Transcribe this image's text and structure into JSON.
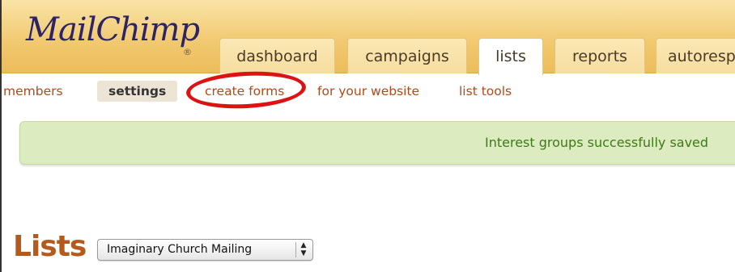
{
  "header": {
    "logo_text": "MailChimp",
    "logo_mark": "®"
  },
  "tabs": [
    {
      "label": "dashboard",
      "active": false
    },
    {
      "label": "campaigns",
      "active": false
    },
    {
      "label": "lists",
      "active": true
    },
    {
      "label": "reports",
      "active": false
    },
    {
      "label": "autoresp",
      "active": false
    }
  ],
  "subnav": {
    "members": "members",
    "settings": "settings",
    "create_forms": "create forms",
    "for_your_website": "for your website",
    "list_tools": "list tools",
    "active": "settings",
    "highlighted": "create forms"
  },
  "alert": {
    "message": "Interest groups successfully saved"
  },
  "page": {
    "title": "Lists",
    "list_select": {
      "selected": "Imaginary Church Mailing",
      "arrows": "▲\n▼"
    }
  },
  "colors": {
    "header_gold": "#f1c86e",
    "link_orange": "#b04a18",
    "alert_green_bg": "#dcebc0",
    "alert_green_text": "#3f7a18",
    "highlight_red": "#dd1313",
    "title_orange": "#b45a1c"
  }
}
